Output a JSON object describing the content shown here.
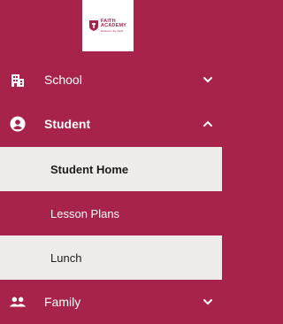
{
  "logo": {
    "line1": "FAITH",
    "line2": "ACADEMY",
    "line3": "Rooted in the Faith"
  },
  "nav": {
    "school": {
      "label": "School",
      "icon": "building-icon",
      "chevron": "chevron-down-icon"
    },
    "student": {
      "label": "Student",
      "icon": "user-circle-icon",
      "chevron": "chevron-up-icon"
    },
    "student_sub": [
      {
        "label": "Student Home",
        "active": true
      },
      {
        "label": "Lesson Plans",
        "active": false
      },
      {
        "label": "Lunch",
        "active": false
      }
    ],
    "family": {
      "label": "Family",
      "icon": "users-icon",
      "chevron": "chevron-down-icon"
    }
  },
  "colors": {
    "brand": "#a8234a",
    "sub_light": "#eeece8"
  }
}
